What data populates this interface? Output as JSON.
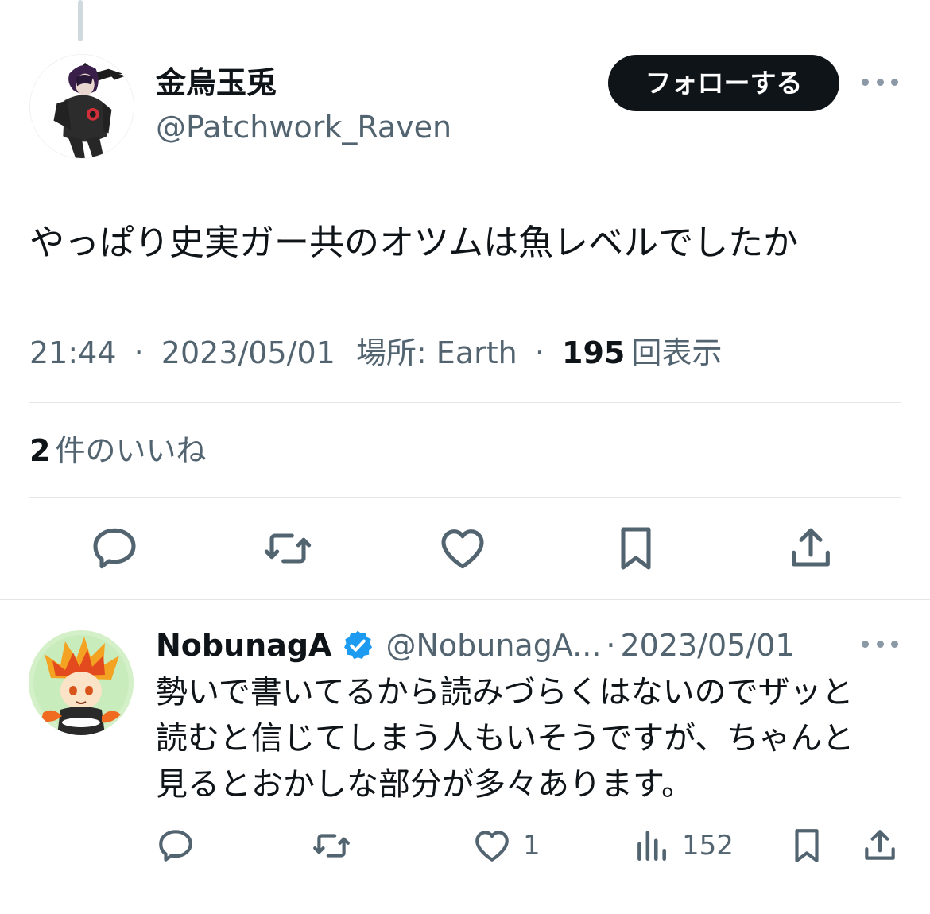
{
  "main_tweet": {
    "display_name": "金烏玉兎",
    "handle": "@Patchwork_Raven",
    "follow_label": "フォローする",
    "text": "やっぱり史実ガー共のオツムは魚レベルでしたか",
    "time": "21:44",
    "date": "2023/05/01",
    "location_label": "場所: Earth",
    "separator": "·",
    "views_count": "195",
    "views_label": "回表示",
    "likes_count": "2",
    "likes_label": "件のいいね",
    "icons": {
      "avatar": "anime-character-avatar",
      "more": "more-icon",
      "reply": "reply-icon",
      "retweet": "retweet-icon",
      "like": "heart-icon",
      "bookmark": "bookmark-icon",
      "share": "share-icon"
    }
  },
  "reply_tweet": {
    "display_name": "NobunagA",
    "handle": "@NobunagA...",
    "separator": "·",
    "date": "2023/05/01",
    "text_lines": [
      "勢いで書いてるから読みづらくはないのでザッと",
      "読むと信じてしまう人もいそうですが、ちゃんと",
      "見るとおかしな部分が多々あります。"
    ],
    "likes_count": "1",
    "views_count": "152",
    "icons": {
      "avatar": "anime-character-avatar",
      "verified": "verified-badge-icon",
      "reply": "reply-icon",
      "retweet": "retweet-icon",
      "like": "heart-icon",
      "views": "views-chart-icon",
      "bookmark": "bookmark-icon",
      "share": "share-icon"
    }
  },
  "colors": {
    "text_primary": "#0f1419",
    "text_secondary": "#536471",
    "divider": "#e3e7ea",
    "verified": "#1d9bf0",
    "follow_bg": "#0f1419"
  }
}
